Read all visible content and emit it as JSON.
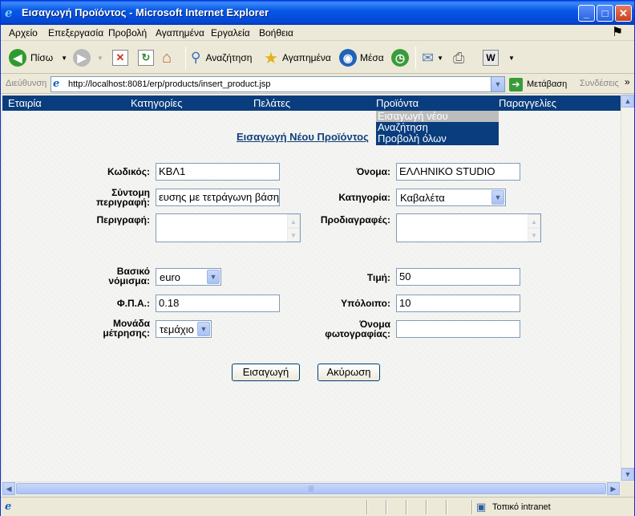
{
  "window": {
    "title": "Εισαγωγή Προϊόντος - Microsoft Internet Explorer"
  },
  "menubar": [
    "Αρχείο",
    "Επεξεργασία",
    "Προβολή",
    "Αγαπημένα",
    "Εργαλεία",
    "Βοήθεια"
  ],
  "toolbar": {
    "back": "Πίσω",
    "search": "Αναζήτηση",
    "favorites": "Αγαπημένα",
    "media": "Μέσα"
  },
  "address": {
    "label": "Διεύθυνση",
    "url": "http://localhost:8081/erp/products/insert_product.jsp",
    "go": "Μετάβαση",
    "links": "Συνδέσεις"
  },
  "nav": {
    "items": [
      "Εταιρία",
      "Κατηγορίες",
      "Πελάτες",
      "Προϊόντα",
      "Παραγγελίες"
    ],
    "submenu": [
      "Εισαγωγή νέου",
      "Αναζήτηση",
      "Προβολή όλων"
    ]
  },
  "form": {
    "heading": "Εισαγωγή Νέου Προϊόντος",
    "code_label": "Κωδικός:",
    "code_value": "ΚΒΛ1",
    "name_label": "Όνομα:",
    "name_value": "ΕΛΛΗΝΙΚΟ STUDIO",
    "short_desc_label_1": "Σύντομη",
    "short_desc_label_2": "περιγραφή:",
    "short_desc_value": "ευσης με τετράγωνη βάση",
    "category_label": "Κατηγορία:",
    "category_value": "Καβαλέτα",
    "description_label": "Περιγραφή:",
    "specs_label": "Προδιαγραφές:",
    "currency_label_1": "Βασικό",
    "currency_label_2": "νόμισμα:",
    "currency_value": "euro",
    "price_label": "Τιμή:",
    "price_value": "50",
    "vat_label": "Φ.Π.Α.:",
    "vat_value": "0.18",
    "stock_label": "Υπόλοιπο:",
    "stock_value": "10",
    "unit_label_1": "Μονάδα",
    "unit_label_2": "μέτρησης:",
    "unit_value": "τεμάχιο",
    "photo_label_1": "Όνομα",
    "photo_label_2": "φωτογραφίας:",
    "photo_value": "",
    "submit_label": "Εισαγωγή",
    "cancel_label": "Ακύρωση"
  },
  "status": {
    "zone": "Τοπικό intranet"
  },
  "colors": {
    "nav_bg": "#0a3d7d",
    "heading": "#10417a",
    "title_bar": "#0758e8"
  }
}
